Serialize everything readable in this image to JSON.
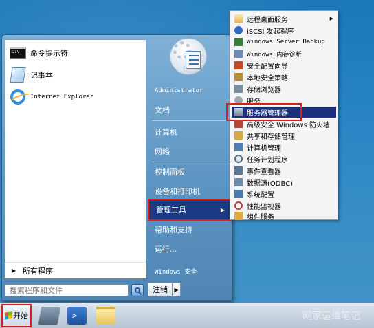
{
  "start_menu": {
    "pinned": [
      {
        "label": "命令提示符",
        "icon": "cmd-icon"
      },
      {
        "label": "记事本",
        "icon": "notepad-icon"
      },
      {
        "label": "Internet Explorer",
        "icon": "ie-icon"
      }
    ],
    "all_programs": "所有程序",
    "search_placeholder": "搜索程序和文件",
    "right_items": [
      {
        "label": "Administrator"
      },
      {
        "label": "文档"
      },
      {
        "label": "计算机"
      },
      {
        "label": "网络"
      },
      {
        "label": "控制面板"
      },
      {
        "label": "设备和打印机"
      },
      {
        "label": "管理工具"
      },
      {
        "label": "帮助和支持"
      },
      {
        "label": "运行..."
      }
    ],
    "windows_security": "Windows 安全",
    "logoff": "注销"
  },
  "admin_tools_menu": {
    "items": [
      {
        "label": "远程桌面服务",
        "icon": "folder-icon",
        "submenu": true
      },
      {
        "label": "iSCSI 发起程序",
        "icon": "iscsi-icon"
      },
      {
        "label": "Windows Server Backup",
        "icon": "backup-icon"
      },
      {
        "label": "Windows 内存诊断",
        "icon": "memory-diagnostic-icon"
      },
      {
        "label": "安全配置向导",
        "icon": "security-wizard-icon"
      },
      {
        "label": "本地安全策略",
        "icon": "local-security-policy-icon"
      },
      {
        "label": "存储浏览器",
        "icon": "storage-explorer-icon"
      },
      {
        "label": "服务",
        "icon": "services-icon"
      },
      {
        "label": "服务器管理器",
        "icon": "server-manager-icon",
        "active": true
      },
      {
        "label": "高级安全 Windows 防火墙",
        "icon": "firewall-icon"
      },
      {
        "label": "共享和存储管理",
        "icon": "share-storage-icon"
      },
      {
        "label": "计算机管理",
        "icon": "computer-management-icon"
      },
      {
        "label": "任务计划程序",
        "icon": "task-scheduler-icon"
      },
      {
        "label": "事件查看器",
        "icon": "event-viewer-icon"
      },
      {
        "label": "数据源(ODBC)",
        "icon": "odbc-icon"
      },
      {
        "label": "系统配置",
        "icon": "system-config-icon"
      },
      {
        "label": "性能监视器",
        "icon": "performance-monitor-icon"
      },
      {
        "label": "组件服务",
        "icon": "component-services-icon"
      }
    ]
  },
  "taskbar": {
    "start_label": "开始",
    "watermark": "网家运维笔记"
  },
  "colors": {
    "highlight_border": "#e21a1a",
    "active_bg": "#1b2f7a"
  }
}
